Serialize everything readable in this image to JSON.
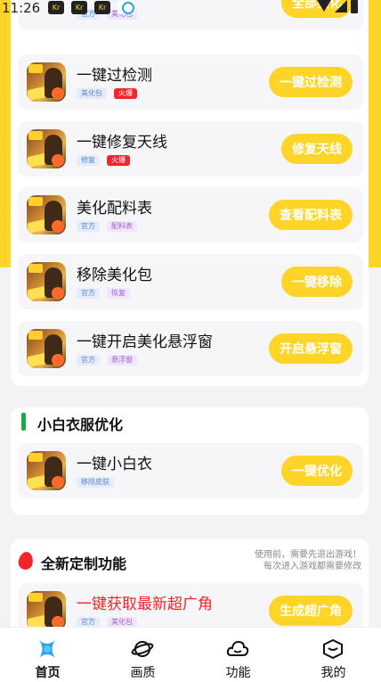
{
  "status_bar": {
    "time": "11:26",
    "badges": [
      "Kr",
      "Kr",
      "Kr"
    ]
  },
  "top_partial_item": {
    "title": "",
    "tags": [
      "官方",
      "美化包"
    ],
    "button": "全部美化"
  },
  "main_items": [
    {
      "title": "一键过检测",
      "tags": [
        {
          "text": "美化包",
          "style": "blue"
        },
        {
          "text": "火爆",
          "style": "red"
        }
      ],
      "button": "一键过检测"
    },
    {
      "title": "一键修复天线",
      "tags": [
        {
          "text": "修复",
          "style": "blue"
        },
        {
          "text": "火爆",
          "style": "red"
        }
      ],
      "button": "修复天线"
    },
    {
      "title": "美化配料表",
      "tags": [
        {
          "text": "官方",
          "style": "blue"
        },
        {
          "text": "配料表",
          "style": "purple"
        }
      ],
      "button": "查看配料表"
    },
    {
      "title": "移除美化包",
      "tags": [
        {
          "text": "官方",
          "style": "blue"
        },
        {
          "text": "恢复",
          "style": "purple"
        }
      ],
      "button": "一键移除"
    },
    {
      "title": "一键开启美化悬浮窗",
      "tags": [
        {
          "text": "官方",
          "style": "blue"
        },
        {
          "text": "悬浮窗",
          "style": "purple"
        }
      ],
      "button": "开启悬浮窗"
    }
  ],
  "section_clothes": {
    "title": "小白衣服优化",
    "item": {
      "title": "一键小白衣",
      "tags": [
        {
          "text": "移除皮肤",
          "style": "blue"
        }
      ],
      "button": "一键优化"
    }
  },
  "section_custom": {
    "title": "全新定制功能",
    "notice_line1": "使用前，需要先退出游戏！",
    "notice_line2": "每次进入游戏都需要修改",
    "item": {
      "title": "一键获取最新超广角",
      "tags": [
        {
          "text": "官方",
          "style": "blue"
        },
        {
          "text": "美化包",
          "style": "purple"
        }
      ],
      "button": "生成超广角"
    }
  },
  "bottom_nav": [
    {
      "label": "首页",
      "icon": "home-icon",
      "active": true
    },
    {
      "label": "画质",
      "icon": "planet-icon",
      "active": false
    },
    {
      "label": "功能",
      "icon": "cloud-icon",
      "active": false
    },
    {
      "label": "我的",
      "icon": "cube-icon",
      "active": false
    }
  ],
  "colors": {
    "accent": "#ffd429",
    "hot": "#f0262a",
    "section_bar": "#13b13b",
    "nav_active": "#29a3ef"
  }
}
